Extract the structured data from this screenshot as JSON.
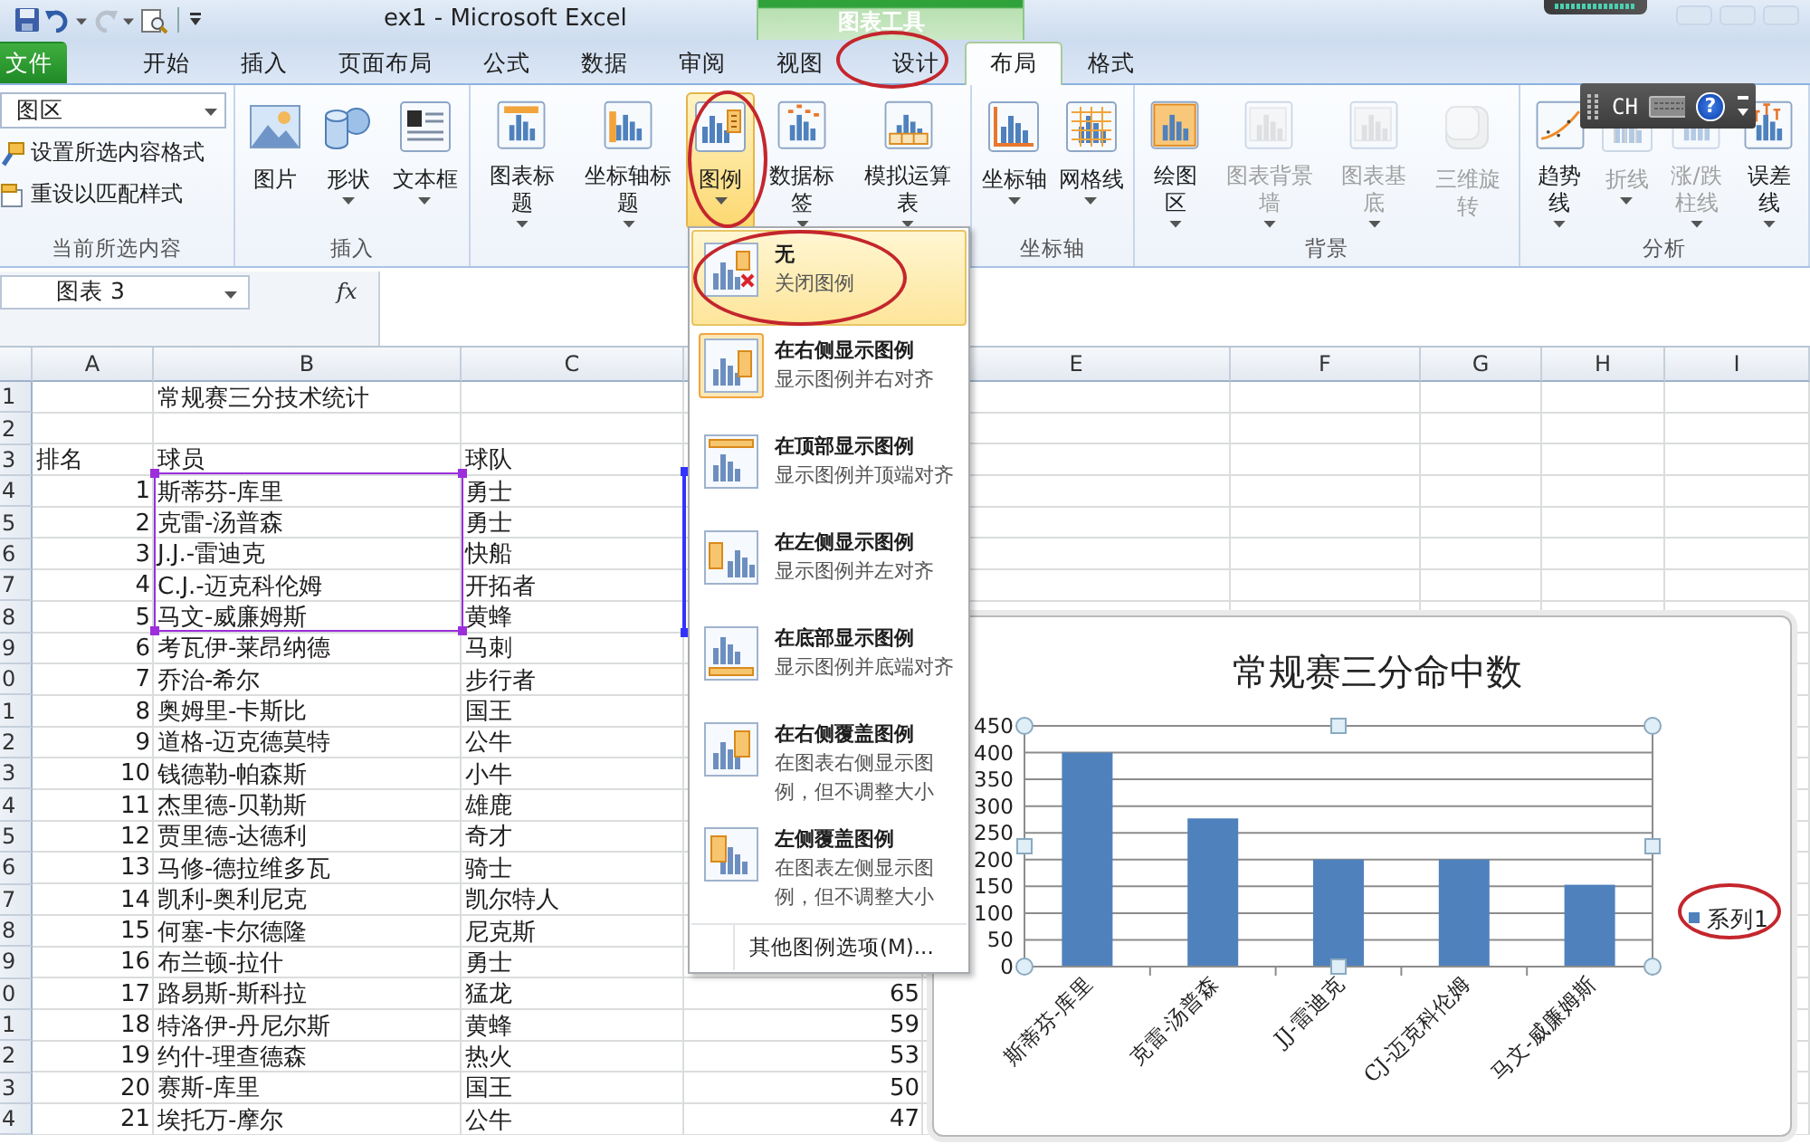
{
  "window": {
    "title": "ex1 - Microsoft Excel",
    "context_tab_group": "图表工具"
  },
  "tabs": [
    {
      "label": "文件",
      "kind": "file",
      "selected": false
    },
    {
      "label": "开始",
      "kind": "normal",
      "selected": false
    },
    {
      "label": "插入",
      "kind": "normal",
      "selected": false
    },
    {
      "label": "页面布局",
      "kind": "normal",
      "selected": false
    },
    {
      "label": "公式",
      "kind": "normal",
      "selected": false
    },
    {
      "label": "数据",
      "kind": "normal",
      "selected": false
    },
    {
      "label": "审阅",
      "kind": "normal",
      "selected": false
    },
    {
      "label": "视图",
      "kind": "normal",
      "selected": false
    },
    {
      "label": "设计",
      "kind": "context",
      "selected": false
    },
    {
      "label": "布局",
      "kind": "context",
      "selected": true
    },
    {
      "label": "格式",
      "kind": "context",
      "selected": false
    }
  ],
  "ribbon_groups": [
    {
      "kind": "selection",
      "label": "当前所选内容",
      "element_dropdown": "图区",
      "commands": [
        {
          "label": "设置所选内容格式",
          "kind": "format"
        },
        {
          "label": "重设以匹配样式",
          "kind": "reset"
        }
      ]
    },
    {
      "kind": "buttons",
      "label": "插入",
      "buttons": [
        {
          "label": "图片",
          "kind": "picture",
          "dropdown": false,
          "disabled": false,
          "highlighted": false
        },
        {
          "label": "形状",
          "kind": "shapes",
          "dropdown": true,
          "disabled": false,
          "highlighted": false
        },
        {
          "label": "文本框",
          "kind": "textbox",
          "dropdown": true,
          "disabled": false,
          "highlighted": false
        }
      ]
    },
    {
      "kind": "buttons",
      "buttons": [
        {
          "label": "图表标题",
          "kind": "chart-title",
          "dropdown": true,
          "disabled": false,
          "highlighted": false
        },
        {
          "label": "坐标轴标题",
          "kind": "axis-title",
          "dropdown": true,
          "disabled": false,
          "highlighted": false
        },
        {
          "label": "图例",
          "kind": "legend",
          "dropdown": true,
          "disabled": false,
          "highlighted": true
        },
        {
          "label": "数据标签",
          "kind": "data-labels",
          "dropdown": true,
          "disabled": false,
          "highlighted": false
        },
        {
          "label": "模拟运算表",
          "kind": "data-table",
          "dropdown": true,
          "disabled": false,
          "highlighted": false
        }
      ]
    },
    {
      "kind": "buttons",
      "label": "坐标轴",
      "buttons": [
        {
          "label": "坐标轴",
          "kind": "axes",
          "dropdown": true,
          "disabled": false,
          "highlighted": false
        },
        {
          "label": "网格线",
          "kind": "gridlines",
          "dropdown": true,
          "disabled": false,
          "highlighted": false
        }
      ]
    },
    {
      "kind": "buttons",
      "label": "背景",
      "buttons": [
        {
          "label": "绘图区",
          "kind": "plot-area",
          "dropdown": true,
          "disabled": false,
          "highlighted": false
        },
        {
          "label": "图表背景墙",
          "kind": "chart-wall",
          "dropdown": true,
          "disabled": true,
          "highlighted": false
        },
        {
          "label": "图表基底",
          "kind": "chart-floor",
          "dropdown": true,
          "disabled": true,
          "highlighted": false
        },
        {
          "label": "三维旋转",
          "kind": "rotation",
          "dropdown": false,
          "disabled": true,
          "highlighted": false
        }
      ]
    },
    {
      "kind": "buttons",
      "label": "分析",
      "buttons": [
        {
          "label": "趋势线",
          "kind": "trendline",
          "dropdown": true,
          "disabled": false,
          "highlighted": false
        },
        {
          "label": "折线",
          "kind": "lines",
          "dropdown": true,
          "disabled": true,
          "highlighted": false
        },
        {
          "label": "涨/跌柱线",
          "kind": "updown-bars",
          "dropdown": true,
          "disabled": true,
          "highlighted": false
        },
        {
          "label": "误差线",
          "kind": "error-bars",
          "dropdown": true,
          "disabled": false,
          "highlighted": false
        }
      ]
    }
  ],
  "language_bar": {
    "label": "CH",
    "help": "?"
  },
  "formula_bar": {
    "name_box": "图表 3",
    "function_label": "fx"
  },
  "sheet": {
    "column_headers": {
      "A": "A",
      "B": "B",
      "C": "C",
      "E": "E",
      "F": "F",
      "G": "G",
      "H": "H",
      "I": "I"
    },
    "rows": [
      {
        "header": "1",
        "cells": {
          "B": "常规赛三分技术统计"
        }
      },
      {
        "header": "2"
      },
      {
        "header": "3",
        "cells": {
          "A": "排名",
          "B": "球员",
          "C": "球队"
        }
      },
      {
        "header": "4",
        "cells": {
          "A": "1",
          "B": "斯蒂芬-库里",
          "C": "勇士"
        }
      },
      {
        "header": "5",
        "cells": {
          "A": "2",
          "B": "克雷-汤普森",
          "C": "勇士"
        }
      },
      {
        "header": "6",
        "cells": {
          "A": "3",
          "B": "J.J.-雷迪克",
          "C": "快船"
        }
      },
      {
        "header": "7",
        "cells": {
          "A": "4",
          "B": "C.J.-迈克科伦姆",
          "C": "开拓者"
        }
      },
      {
        "header": "8",
        "cells": {
          "A": "5",
          "B": "马文-威廉姆斯",
          "C": "黄蜂"
        }
      },
      {
        "header": "9",
        "cells": {
          "A": "6",
          "B": "考瓦伊-莱昂纳德",
          "C": "马刺"
        }
      },
      {
        "header": "0",
        "cells": {
          "A": "7",
          "B": "乔治-希尔",
          "C": "步行者"
        }
      },
      {
        "header": "1",
        "cells": {
          "A": "8",
          "B": "奥姆里-卡斯比",
          "C": "国王"
        }
      },
      {
        "header": "2",
        "cells": {
          "A": "9",
          "B": "道格-迈克德莫特",
          "C": "公牛"
        }
      },
      {
        "header": "3",
        "cells": {
          "A": "10",
          "B": "钱德勒-帕森斯",
          "C": "小牛"
        }
      },
      {
        "header": "4",
        "cells": {
          "A": "11",
          "B": "杰里德-贝勒斯",
          "C": "雄鹿"
        }
      },
      {
        "header": "5",
        "cells": {
          "A": "12",
          "B": "贾里德-达德利",
          "C": "奇才"
        }
      },
      {
        "header": "6",
        "cells": {
          "A": "13",
          "B": "马修-德拉维多瓦",
          "C": "骑士"
        }
      },
      {
        "header": "7",
        "cells": {
          "A": "14",
          "B": "凯利-奥利尼克",
          "C": "凯尔特人"
        }
      },
      {
        "header": "8",
        "cells": {
          "A": "15",
          "B": "何塞-卡尔德隆",
          "C": "尼克斯"
        }
      },
      {
        "header": "9",
        "cells": {
          "A": "16",
          "B": "布兰顿-拉什",
          "C": "勇士"
        }
      },
      {
        "header": "0",
        "cells": {
          "A": "17",
          "B": "路易斯-斯科拉",
          "C": "猛龙",
          "D": "65"
        }
      },
      {
        "header": "1",
        "cells": {
          "A": "18",
          "B": "特洛伊-丹尼尔斯",
          "C": "黄蜂",
          "D": "59"
        }
      },
      {
        "header": "2",
        "cells": {
          "A": "19",
          "B": "约什-理查德森",
          "C": "热火",
          "D": "53"
        }
      },
      {
        "header": "3",
        "cells": {
          "A": "20",
          "B": "赛斯-库里",
          "C": "国王",
          "D": "50"
        }
      },
      {
        "header": "4",
        "cells": {
          "A": "21",
          "B": "埃托万-摩尔",
          "C": "公牛",
          "D": "47"
        }
      }
    ]
  },
  "legend_menu": {
    "items": [
      {
        "kind": "none",
        "title": "无",
        "description": "关闭图例",
        "highlighted": true,
        "selected": false
      },
      {
        "kind": "right",
        "title": "在右侧显示图例",
        "description": "显示图例并右对齐",
        "highlighted": false,
        "selected": true
      },
      {
        "kind": "top",
        "title": "在顶部显示图例",
        "description": "显示图例并顶端对齐",
        "highlighted": false,
        "selected": false
      },
      {
        "kind": "left",
        "title": "在左侧显示图例",
        "description": "显示图例并左对齐",
        "highlighted": false,
        "selected": false
      },
      {
        "kind": "bottom",
        "title": "在底部显示图例",
        "description": "显示图例并底端对齐",
        "highlighted": false,
        "selected": false
      },
      {
        "kind": "overlay-right",
        "title": "在右侧覆盖图例",
        "description": "在图表右侧显示图例，但不调整大小",
        "highlighted": false,
        "selected": false
      },
      {
        "kind": "overlay-left",
        "title": "左侧覆盖图例",
        "description": "在图表左侧显示图例，但不调整大小",
        "highlighted": false,
        "selected": false
      }
    ],
    "footer": "其他图例选项(M)..."
  },
  "chart": {
    "chart_data": {
      "type": "bar",
      "title": "常规赛三分命中数",
      "categories": [
        "斯蒂芬-库里",
        "克雷-汤普森",
        "JJ-雷迪克",
        "CJ-迈克科伦姆",
        "马文-威廉姆斯"
      ],
      "series": [
        {
          "name": "系列1",
          "color": "#4f81bd",
          "values": [
            400,
            277,
            200,
            200,
            153
          ]
        }
      ],
      "ylim": [
        0,
        450
      ],
      "yticks": [
        0,
        50,
        100,
        150,
        200,
        250,
        300,
        350,
        400,
        450
      ],
      "grid": true
    }
  }
}
